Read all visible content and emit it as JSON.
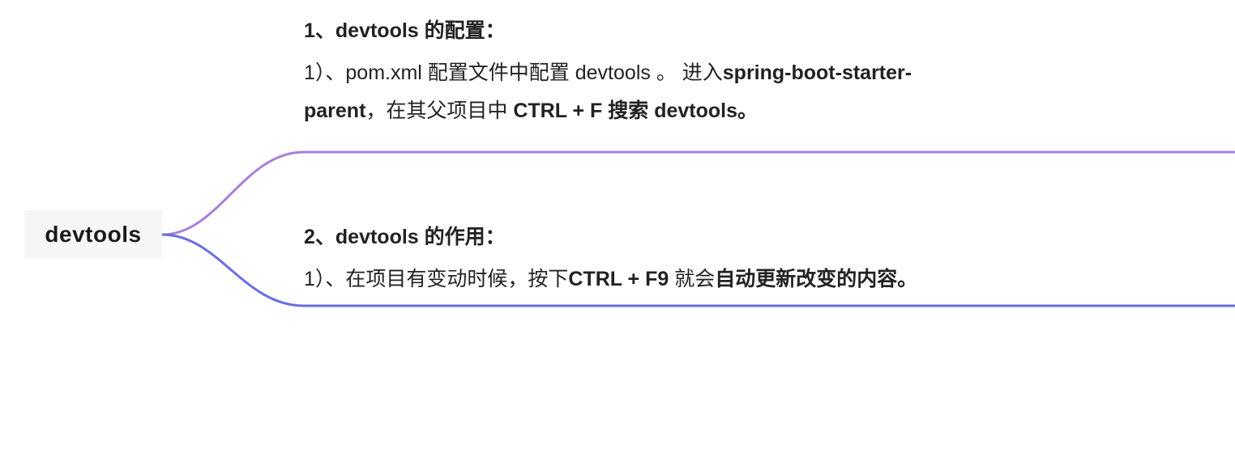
{
  "root": {
    "label": "devtools"
  },
  "block1": {
    "heading": "1、devtools 的配置：",
    "body_part1": "1）、pom.xml 配置文件中配置 devtools 。  进入",
    "body_bold1": "spring-boot-starter-parent",
    "body_part2": "，在其父项目中 ",
    "body_bold2": "CTRL + F 搜索 devtools。"
  },
  "block2": {
    "heading": "2、devtools 的作用：",
    "body_part1": "1）、在项目有变动时候，按下",
    "body_bold1": "CTRL + F9 ",
    "body_part2": "就会",
    "body_bold2": "自动更新改变的内容。"
  },
  "colors": {
    "line_top": "#a77fd9",
    "line_bottom": "#6a6ee0"
  }
}
